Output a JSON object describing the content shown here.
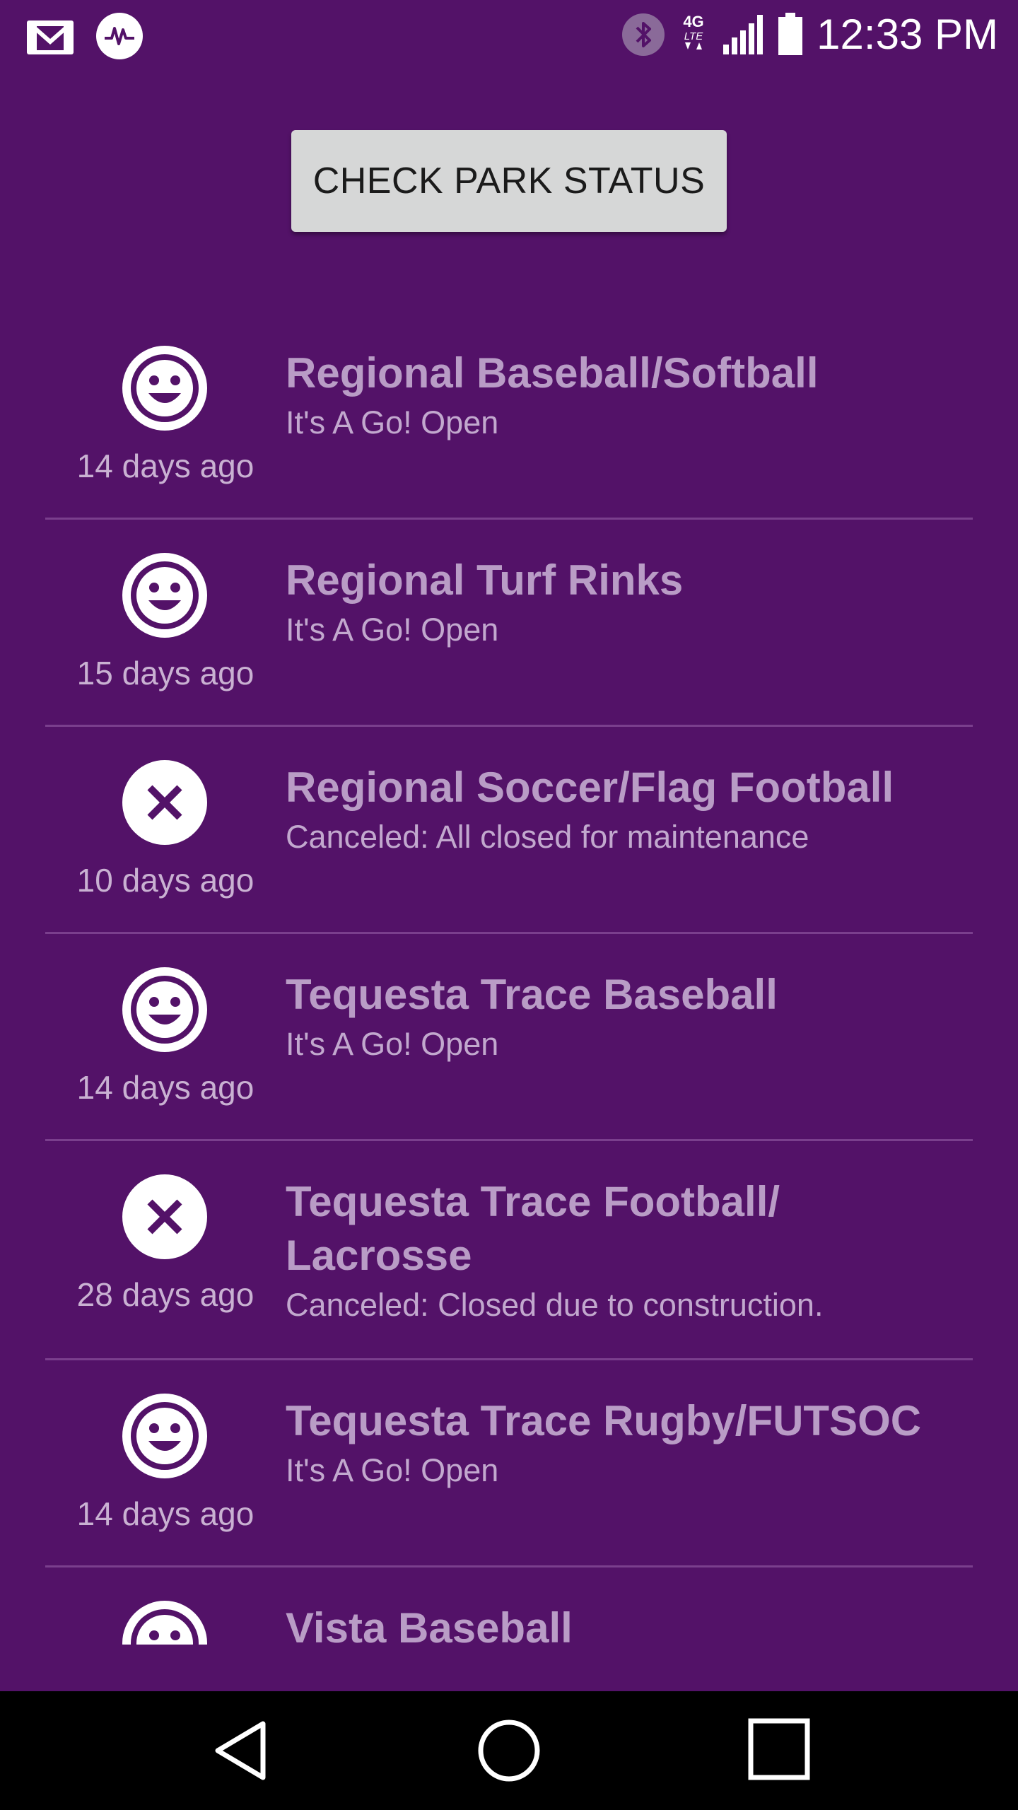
{
  "status_bar": {
    "time": "12:33 PM",
    "left_icons": [
      "gmail-icon",
      "musically-icon"
    ],
    "right_icons": [
      "bluetooth-icon",
      "4g-lte-icon",
      "signal-icon",
      "battery-icon"
    ],
    "network_label": "4G",
    "network_sub_label": "LTE"
  },
  "check_button": {
    "label": "CHECK PARK STATUS"
  },
  "parks": [
    {
      "name": "Regional Baseball/Softball",
      "status": "It's A Go! Open",
      "time": "14 days ago",
      "state": "open",
      "icon": "smiley-icon"
    },
    {
      "name": "Regional Turf Rinks",
      "status": "It's A Go! Open",
      "time": "15 days ago",
      "state": "open",
      "icon": "smiley-icon"
    },
    {
      "name": "Regional Soccer/Flag Football",
      "status": "Canceled: All closed for maintenance",
      "time": "10 days ago",
      "state": "closed",
      "icon": "close-circle-icon"
    },
    {
      "name": "Tequesta Trace Baseball",
      "status": "It's A Go! Open",
      "time": "14 days ago",
      "state": "open",
      "icon": "smiley-icon"
    },
    {
      "name": "Tequesta Trace Football/ Lacrosse",
      "name_line1": "Tequesta Trace Football/",
      "name_line2": "Lacrosse",
      "status": "Canceled: Closed due to construction.",
      "time": "28 days ago",
      "state": "closed",
      "icon": "close-circle-icon"
    },
    {
      "name": "Tequesta Trace Rugby/FUTSOC",
      "status": "It's A Go! Open",
      "time": "14 days ago",
      "state": "open",
      "icon": "smiley-icon"
    },
    {
      "name": "Vista Baseball",
      "state": "open",
      "icon": "smiley-icon"
    }
  ],
  "nav_bar": {
    "buttons": [
      "back-icon",
      "home-icon",
      "recents-icon"
    ]
  },
  "colors": {
    "background": "#531268",
    "button_bg": "#d6d7d7",
    "title_text": "#b99cc6",
    "status_text": "#c2a8ce",
    "divider": "#7a3f8d",
    "nav_bg": "#000000"
  }
}
